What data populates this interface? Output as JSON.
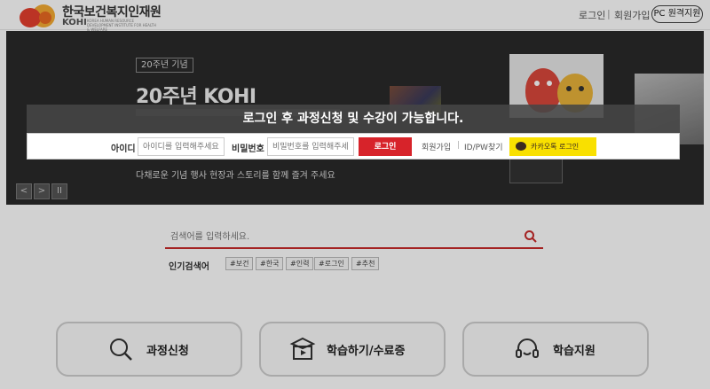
{
  "header": {
    "brand_ko": "한국보건복지인재원",
    "brand_en": "KOHI",
    "brand_en_sub": "KOREA HUMAN RESOURCE DEVELOPMENT INSTITUTE FOR HEALTH & WELFARE",
    "login_link": "로그인",
    "separator": "|",
    "signup_link": "회원가입",
    "pc_button": "PC 원격지원"
  },
  "hero": {
    "tag": "20주년 기념",
    "title": "20주년 KOHI",
    "description": "다채로운 기념 행사 현장과 스토리를 함께 즐겨 주세요",
    "controls": {
      "prev": "<",
      "next": ">",
      "pause": "II"
    }
  },
  "login_overlay": {
    "banner": "로그인 후 과정신청 및 수강이 가능합니다.",
    "id_label": "아이디",
    "id_placeholder": "아이디를 입력해주세요",
    "pw_label": "비밀번호",
    "pw_placeholder": "비밀번호를 입력해주세요",
    "login_button": "로그인",
    "signup_link": "회원가입",
    "find_link": "ID/PW찾기",
    "kakao_button": "카카오톡 로그인"
  },
  "search": {
    "placeholder": "검색어를 입력하세요.",
    "popular_label": "인기검색어",
    "popular_tags": [
      "#보건",
      "#한국",
      "#인력",
      "#로그인",
      "#추천"
    ]
  },
  "quick_menu": [
    {
      "label": "과정신청",
      "icon": "search-icon"
    },
    {
      "label": "학습하기/수료증",
      "icon": "study-icon"
    },
    {
      "label": "학습지원",
      "icon": "headset-icon"
    }
  ],
  "colors": {
    "accent_red": "#d7232a",
    "kakao_yellow": "#f9e000",
    "hero_bg": "#2a2a2a"
  }
}
